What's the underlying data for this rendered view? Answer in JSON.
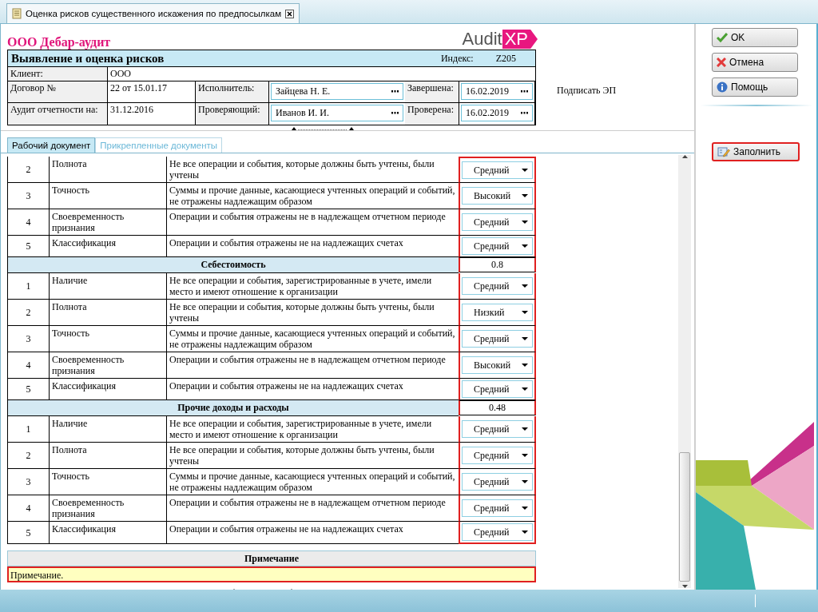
{
  "document_tab": {
    "title": "Оценка рисков существенного искажения по предпосылкам"
  },
  "company": "ООО Дебар-аудит",
  "logo": {
    "text": "Audit",
    "badge": "XP"
  },
  "form": {
    "title": "Выявление и оценка рисков",
    "index_label": "Индекс:",
    "index": "Z205",
    "client_label": "Клиент:",
    "client": "ООО",
    "contract_label": "Договор №",
    "contract": "22 от 15.01.17",
    "period_label": "Аудит отчетности на:",
    "period": "31.12.2016",
    "performer_label": "Исполнитель:",
    "performer": "Зайцева Н. Е.",
    "reviewer_label": "Проверяющий:",
    "reviewer": "Иванов И. И.",
    "completed_label": "Завершена:",
    "completed": "16.02.2019",
    "checked_label": "Проверена:",
    "checked": "16.02.2019"
  },
  "sign_link": "Подписать ЭП",
  "doc_tabs": [
    {
      "label": "Рабочий документ",
      "selected": true
    },
    {
      "label": "Прикрепленные документы",
      "selected": false
    }
  ],
  "risk_column_highlighted": true,
  "groups": [
    {
      "rows": [
        {
          "num": "2",
          "assertion": "Полнота",
          "description": "Не все операции и события, которые должны быть учтены, были учтены",
          "risk": "Средний"
        },
        {
          "num": "3",
          "assertion": "Точность",
          "description": "Суммы и прочие данные, касающиеся учтенных операций и событий, не отражены надлежащим образом",
          "risk": "Высокий"
        },
        {
          "num": "4",
          "assertion": "Своевременность признания",
          "description": "Операции и события отражены не в надлежащем отчетном периоде",
          "risk": "Средний"
        },
        {
          "num": "5",
          "assertion": "Классификация",
          "description": "Операции и события отражены не на надлежащих счетах",
          "risk": "Средний"
        }
      ]
    },
    {
      "title": "Себестоимость",
      "score": "0.8",
      "rows": [
        {
          "num": "1",
          "assertion": "Наличие",
          "description": "Не все операции и события, зарегистрированные в учете, имели место и имеют отношение к организации",
          "risk": "Средний"
        },
        {
          "num": "2",
          "assertion": "Полнота",
          "description": "Не все операции и события, которые должны быть учтены, были учтены",
          "risk": "Низкий"
        },
        {
          "num": "3",
          "assertion": "Точность",
          "description": "Суммы и прочие данные, касающиеся учтенных операций и событий, не отражены надлежащим образом",
          "risk": "Средний"
        },
        {
          "num": "4",
          "assertion": "Своевременность признания",
          "description": "Операции и события отражены не в надлежащем отчетном периоде",
          "risk": "Высокий"
        },
        {
          "num": "5",
          "assertion": "Классификация",
          "description": "Операции и события отражены не на надлежащих счетах",
          "risk": "Средний"
        }
      ]
    },
    {
      "title": "Прочие доходы и расходы",
      "score": "0.48",
      "rows": [
        {
          "num": "1",
          "assertion": "Наличие",
          "description": "Не все операции и события, зарегистрированные в учете, имели место и имеют отношение к организации",
          "risk": "Средний"
        },
        {
          "num": "2",
          "assertion": "Полнота",
          "description": "Не все операции и события, которые должны быть учтены, были учтены",
          "risk": "Средний"
        },
        {
          "num": "3",
          "assertion": "Точность",
          "description": "Суммы и прочие данные, касающиеся учтенных операций и событий, не отражены надлежащим образом",
          "risk": "Средний"
        },
        {
          "num": "4",
          "assertion": "Своевременность признания",
          "description": "Операции и события отражены не в надлежащем отчетном периоде",
          "risk": "Средний"
        },
        {
          "num": "5",
          "assertion": "Классификация",
          "description": "Операции и события отражены не на надлежащих счетах",
          "risk": "Средний"
        }
      ]
    }
  ],
  "note": {
    "title": "Примечание",
    "value": "Примечание.",
    "highlighted": true
  },
  "buttons": [
    {
      "kind": "ok",
      "label": "OK"
    },
    {
      "kind": "cancel",
      "label": "Отмена"
    },
    {
      "kind": "help",
      "label": "Помощь"
    }
  ],
  "fill_button": {
    "label": "Заполнить",
    "highlighted": true
  }
}
